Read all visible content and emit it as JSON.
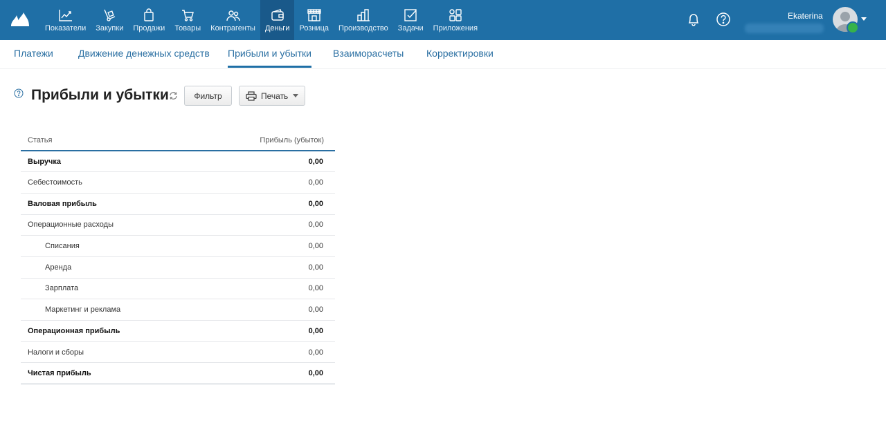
{
  "nav": {
    "items": [
      {
        "label": "Показатели",
        "icon": "chart-line-icon",
        "active": false
      },
      {
        "label": "Закупки",
        "icon": "hand-truck-icon",
        "active": false
      },
      {
        "label": "Продажи",
        "icon": "shopping-bag-icon",
        "active": false
      },
      {
        "label": "Товары",
        "icon": "cart-icon",
        "active": false
      },
      {
        "label": "Контрагенты",
        "icon": "people-icon",
        "active": false
      },
      {
        "label": "Деньги",
        "icon": "wallet-icon",
        "active": true
      },
      {
        "label": "Розница",
        "icon": "store-icon",
        "active": false
      },
      {
        "label": "Производство",
        "icon": "factory-icon",
        "active": false
      },
      {
        "label": "Задачи",
        "icon": "checkbox-icon",
        "active": false
      },
      {
        "label": "Приложения",
        "icon": "apps-icon",
        "active": false
      }
    ]
  },
  "user": {
    "name": "Ekaterina"
  },
  "subtabs": [
    {
      "label": "Платежи",
      "active": false
    },
    {
      "label": "Движение денежных средств",
      "active": false
    },
    {
      "label": "Прибыли и убытки",
      "active": true
    },
    {
      "label": "Взаиморасчеты",
      "active": false
    },
    {
      "label": "Корректировки",
      "active": false
    }
  ],
  "page": {
    "title": "Прибыли и убытки",
    "filter_label": "Фильтр",
    "print_label": "Печать"
  },
  "report": {
    "headers": [
      "Статья",
      "Прибыль (убыток)"
    ],
    "rows": [
      {
        "label": "Выручка",
        "value": "0,00",
        "bold": true,
        "indent": false
      },
      {
        "label": "Себестоимость",
        "value": "0,00",
        "bold": false,
        "indent": false
      },
      {
        "label": "Валовая прибыль",
        "value": "0,00",
        "bold": true,
        "indent": false
      },
      {
        "label": "Операционные расходы",
        "value": "0,00",
        "bold": false,
        "indent": false
      },
      {
        "label": "Списания",
        "value": "0,00",
        "bold": false,
        "indent": true
      },
      {
        "label": "Аренда",
        "value": "0,00",
        "bold": false,
        "indent": true
      },
      {
        "label": "Зарплата",
        "value": "0,00",
        "bold": false,
        "indent": true
      },
      {
        "label": "Маркетинг и реклама",
        "value": "0,00",
        "bold": false,
        "indent": true
      },
      {
        "label": "Операционная прибыль",
        "value": "0,00",
        "bold": true,
        "indent": false
      },
      {
        "label": "Налоги и сборы",
        "value": "0,00",
        "bold": false,
        "indent": false
      },
      {
        "label": "Чистая прибыль",
        "value": "0,00",
        "bold": true,
        "indent": false
      }
    ]
  },
  "colors": {
    "topbar": "#1f6fa6",
    "active_nav": "#19598a",
    "link": "#2a6fa2",
    "badge": "#36b24a"
  }
}
